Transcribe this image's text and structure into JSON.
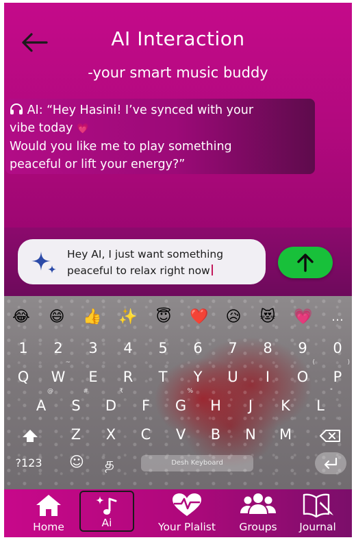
{
  "header": {
    "title": "AI Interaction",
    "subtitle": "-your smart music buddy"
  },
  "chat": {
    "line1": "AI: “Hey Hasini! I’ve synced with your",
    "line2": "vibe today",
    "heart": "💗",
    "line3": " Would you like me to play something",
    "line4": "peaceful or lift your energy?”"
  },
  "input": {
    "line1": "Hey AI, I just want something",
    "line2": "peaceful to relax right now"
  },
  "keyboard": {
    "emojis": [
      "😂",
      "😄",
      "👍",
      "✨",
      "😇",
      "❤️",
      "😥",
      "😻",
      "💗"
    ],
    "more": "…",
    "numbers": [
      "1",
      "2",
      "3",
      "4",
      "5",
      "6",
      "7",
      "8",
      "9",
      "0"
    ],
    "row1": [
      "Q",
      "W",
      "E",
      "R",
      "T",
      "Y",
      "U",
      "I",
      "O",
      "P"
    ],
    "row1_hints": [
      "",
      "~",
      "",
      "",
      "",
      "",
      "",
      "",
      "(",
      ")"
    ],
    "row2": [
      "A",
      "S",
      "D",
      "F",
      "G",
      "H",
      "J",
      "K",
      "L"
    ],
    "row2_hints": [
      "@",
      "#",
      "₹",
      "",
      "%",
      "",
      "",
      "",
      "\""
    ],
    "row3": [
      "Z",
      "X",
      "C",
      "V",
      "B",
      "N",
      "M"
    ],
    "sym_key": "?123",
    "emoji_key": "☺",
    "lang_key": "த",
    "space_label": "Desh Keyboard"
  },
  "nav": {
    "home": "Home",
    "ai": "Ai",
    "playlist": "Your Plalist",
    "groups": "Groups",
    "journal": "Journal"
  },
  "colors": {
    "accent": "#c40a8a",
    "send": "#18c03a"
  }
}
